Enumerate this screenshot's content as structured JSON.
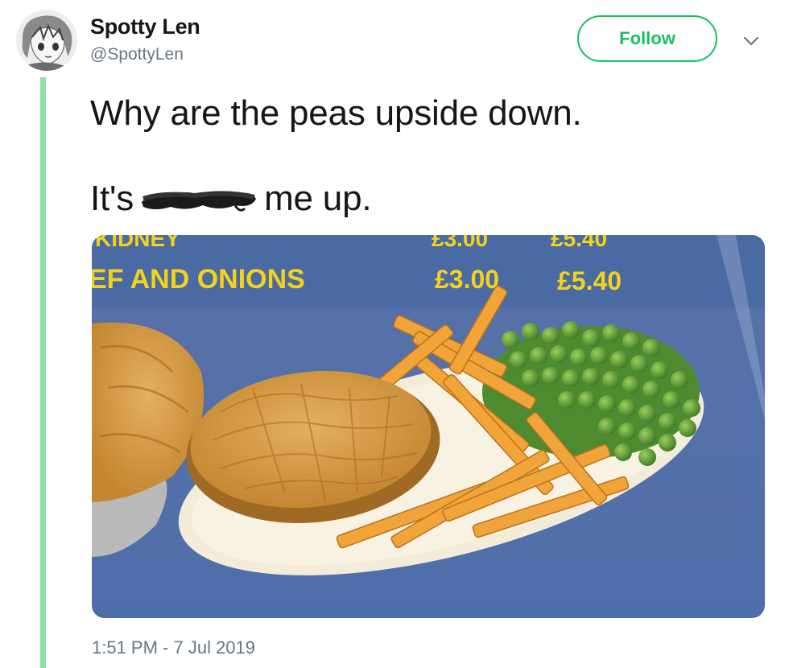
{
  "tweet": {
    "display_name": "Spotty Len",
    "handle": "@SpottyLen",
    "follow_label": "Follow",
    "text_line1": "Why are the peas upside down.",
    "text_line2_before": "It's",
    "text_line2_after": "me up.",
    "timestamp": "1:51 PM - 7 Jul 2019"
  },
  "photo": {
    "menu_row1_left": "KIDNEY",
    "menu_row1_price1": "£3.00",
    "menu_row1_price2": "£5.40",
    "menu_row2_item": "EF AND ONIONS",
    "menu_row2_price1": "£3.00",
    "menu_row2_price2": "£5.40"
  },
  "colors": {
    "accent": "#17bf63",
    "thread_line": "#8fe0a7",
    "secondary_text": "#657786",
    "menu_text": "#f4d21c",
    "menu_background": "#5a78ad"
  },
  "icons": {
    "more": "chevron-down-icon"
  }
}
